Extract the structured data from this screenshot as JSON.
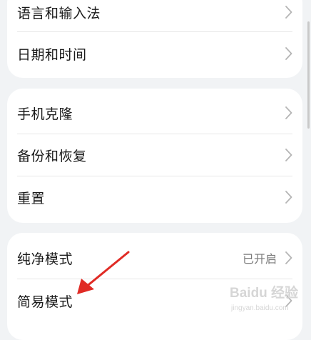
{
  "groups": [
    {
      "items": [
        {
          "label": "语言和输入法"
        },
        {
          "label": "日期和时间"
        }
      ]
    },
    {
      "items": [
        {
          "label": "手机克隆"
        },
        {
          "label": "备份和恢复"
        },
        {
          "label": "重置"
        }
      ]
    },
    {
      "items": [
        {
          "label": "纯净模式",
          "value": "已开启"
        },
        {
          "label": "简易模式"
        }
      ]
    }
  ],
  "colors": {
    "background": "#f1f3f5",
    "card": "#ffffff",
    "text": "#1a1a1a",
    "secondary_text": "#7a7a7a",
    "chevron": "#b5b5b5",
    "annotation_arrow": "#e02b25"
  },
  "icons": {
    "chevron": "chevron-right-icon",
    "annotation": "annotation-arrow-icon"
  },
  "watermark": {
    "logo_text": "Baidu 经验",
    "url_text": "jingyan.baidu.com"
  }
}
